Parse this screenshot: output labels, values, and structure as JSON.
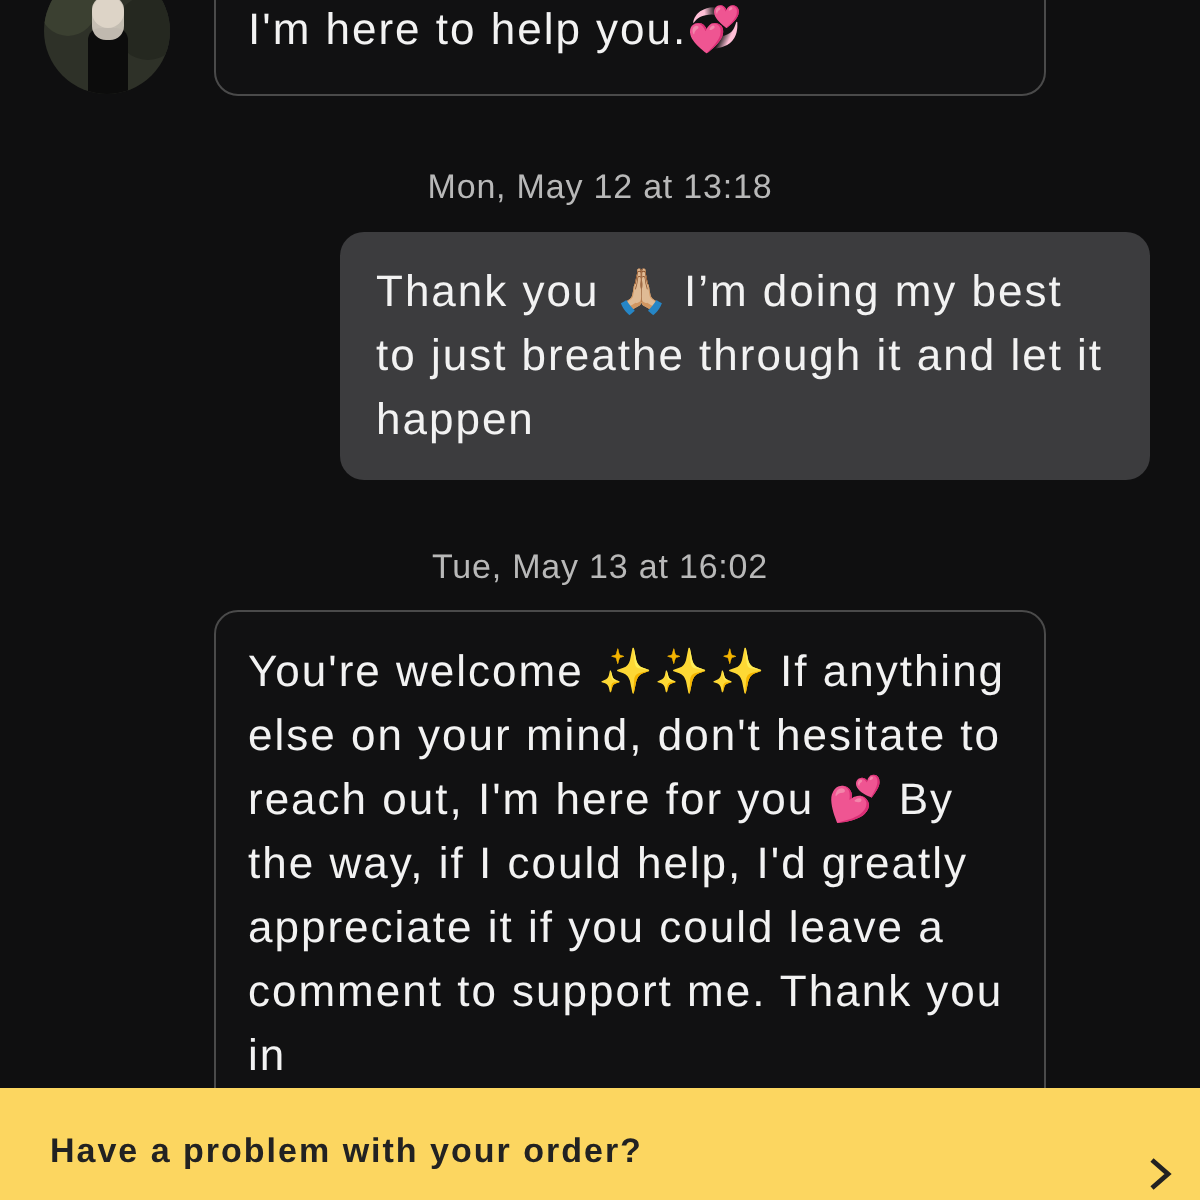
{
  "messages": [
    {
      "kind": "incoming",
      "avatar": true,
      "text": "I'm here to help you.💞"
    },
    {
      "kind": "timestamp",
      "text": "Mon, May 12 at 13:18"
    },
    {
      "kind": "outgoing",
      "text": "Thank you 🙏🏼 I’m doing my best to just breathe through it and let it happen"
    },
    {
      "kind": "timestamp",
      "text": "Tue, May 13 at 16:02"
    },
    {
      "kind": "incoming",
      "avatar": false,
      "text": "You're welcome ✨✨✨ If anything else on your mind, don't hesitate to reach out, I'm here for you 💕 By the way, if I could help, I'd greatly appreciate it if you could leave a comment to support me. Thank you in"
    }
  ],
  "banner": {
    "title": "Have a problem with your order?"
  }
}
